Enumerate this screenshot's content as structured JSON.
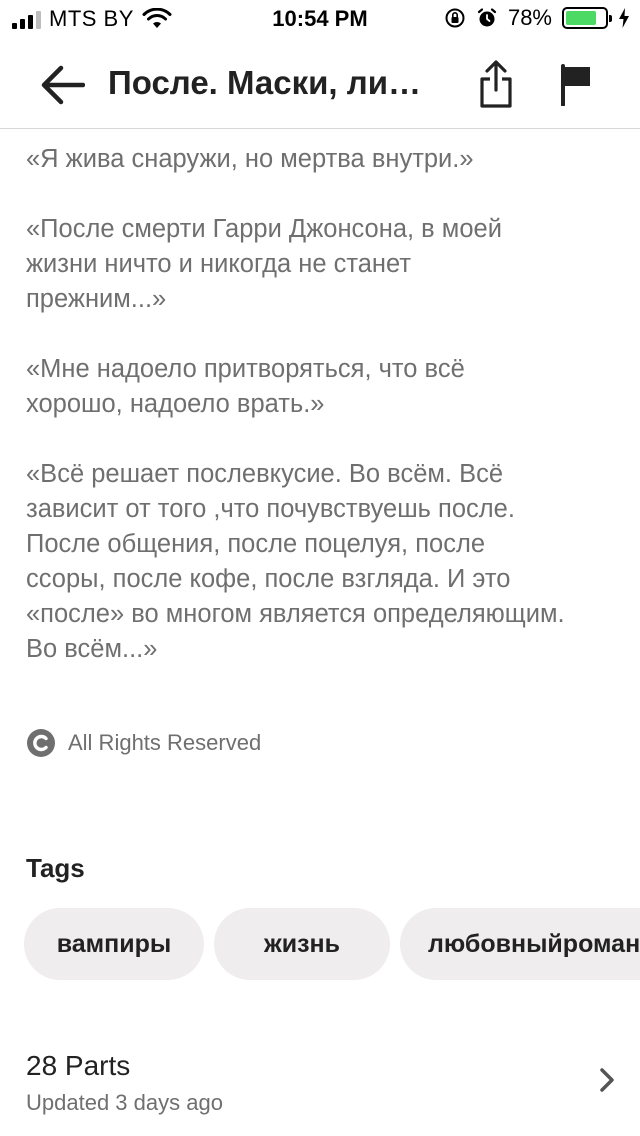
{
  "status_bar": {
    "carrier": "MTS BY",
    "time": "10:54 PM",
    "battery_text": "78%",
    "battery_level": 0.78
  },
  "nav": {
    "title": "После. Маски, лицемерие и ложь"
  },
  "story": {
    "paragraphs": [
      "«Я жива снаружи, но мертва внутри.»",
      "«После смерти Гарри Джонсона, в моей\nжизни ничто и никогда не станет\nпрежним...»",
      "«Мне надоело притворяться, что всё\nхорошо, надоело врать.»",
      "«Всё решает послевкусие. Во всём. Всё\nзависит от того ,что почувствуешь после.\nПосле общения, после поцелуя, после\nссоры, после кофе, после взгляда. И это\n«после» во многом является определяющим.\nВо всём...»"
    ],
    "copyright": "All Rights Reserved"
  },
  "tags": {
    "heading": "Tags",
    "items": [
      "вампиры",
      "жизнь",
      "любовныйроман"
    ]
  },
  "parts": {
    "count": "28 Parts",
    "updated": "Updated 3 days ago"
  },
  "colors": {
    "accent_battery": "#4cd964",
    "text_primary": "#222222",
    "text_secondary": "#6f6f6f",
    "pill_bg": "#efeded"
  }
}
